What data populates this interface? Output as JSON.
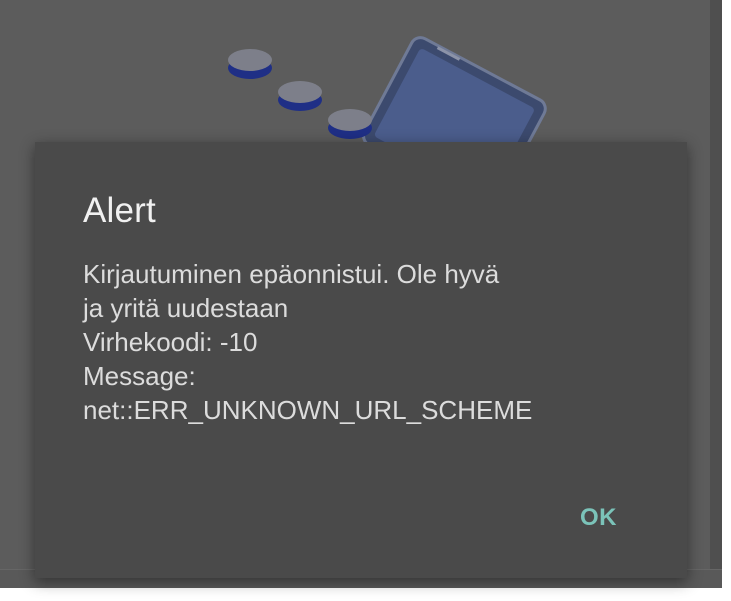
{
  "dialog": {
    "title": "Alert",
    "message_lines": [
      "Kirjautuminen epäonnistui. Ole hyvä",
      "ja yritä uudestaan",
      "Virhekoodi: -10",
      "Message:",
      "net::ERR_UNKNOWN_URL_SCHEME"
    ],
    "ok_label": "OK"
  },
  "colors": {
    "overlay": "#5c5c5c",
    "dialog_background": "#4a4a4a",
    "title_text": "#f1f1f1",
    "body_text": "#dcdcdc",
    "accent": "#7bc3b9",
    "illustration_blue": "#1f2f86"
  }
}
